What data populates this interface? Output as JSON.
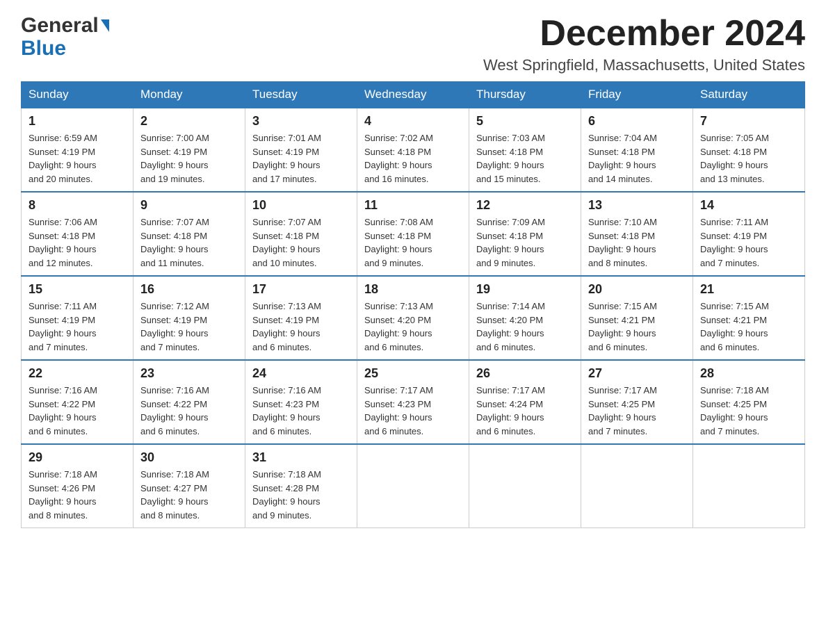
{
  "header": {
    "logo_general": "General",
    "logo_blue": "Blue",
    "month_title": "December 2024",
    "location": "West Springfield, Massachusetts, United States"
  },
  "days_of_week": [
    "Sunday",
    "Monday",
    "Tuesday",
    "Wednesday",
    "Thursday",
    "Friday",
    "Saturday"
  ],
  "weeks": [
    [
      {
        "day": "1",
        "sunrise": "6:59 AM",
        "sunset": "4:19 PM",
        "daylight": "9 hours and 20 minutes."
      },
      {
        "day": "2",
        "sunrise": "7:00 AM",
        "sunset": "4:19 PM",
        "daylight": "9 hours and 19 minutes."
      },
      {
        "day": "3",
        "sunrise": "7:01 AM",
        "sunset": "4:19 PM",
        "daylight": "9 hours and 17 minutes."
      },
      {
        "day": "4",
        "sunrise": "7:02 AM",
        "sunset": "4:18 PM",
        "daylight": "9 hours and 16 minutes."
      },
      {
        "day": "5",
        "sunrise": "7:03 AM",
        "sunset": "4:18 PM",
        "daylight": "9 hours and 15 minutes."
      },
      {
        "day": "6",
        "sunrise": "7:04 AM",
        "sunset": "4:18 PM",
        "daylight": "9 hours and 14 minutes."
      },
      {
        "day": "7",
        "sunrise": "7:05 AM",
        "sunset": "4:18 PM",
        "daylight": "9 hours and 13 minutes."
      }
    ],
    [
      {
        "day": "8",
        "sunrise": "7:06 AM",
        "sunset": "4:18 PM",
        "daylight": "9 hours and 12 minutes."
      },
      {
        "day": "9",
        "sunrise": "7:07 AM",
        "sunset": "4:18 PM",
        "daylight": "9 hours and 11 minutes."
      },
      {
        "day": "10",
        "sunrise": "7:07 AM",
        "sunset": "4:18 PM",
        "daylight": "9 hours and 10 minutes."
      },
      {
        "day": "11",
        "sunrise": "7:08 AM",
        "sunset": "4:18 PM",
        "daylight": "9 hours and 9 minutes."
      },
      {
        "day": "12",
        "sunrise": "7:09 AM",
        "sunset": "4:18 PM",
        "daylight": "9 hours and 9 minutes."
      },
      {
        "day": "13",
        "sunrise": "7:10 AM",
        "sunset": "4:18 PM",
        "daylight": "9 hours and 8 minutes."
      },
      {
        "day": "14",
        "sunrise": "7:11 AM",
        "sunset": "4:19 PM",
        "daylight": "9 hours and 7 minutes."
      }
    ],
    [
      {
        "day": "15",
        "sunrise": "7:11 AM",
        "sunset": "4:19 PM",
        "daylight": "9 hours and 7 minutes."
      },
      {
        "day": "16",
        "sunrise": "7:12 AM",
        "sunset": "4:19 PM",
        "daylight": "9 hours and 7 minutes."
      },
      {
        "day": "17",
        "sunrise": "7:13 AM",
        "sunset": "4:19 PM",
        "daylight": "9 hours and 6 minutes."
      },
      {
        "day": "18",
        "sunrise": "7:13 AM",
        "sunset": "4:20 PM",
        "daylight": "9 hours and 6 minutes."
      },
      {
        "day": "19",
        "sunrise": "7:14 AM",
        "sunset": "4:20 PM",
        "daylight": "9 hours and 6 minutes."
      },
      {
        "day": "20",
        "sunrise": "7:15 AM",
        "sunset": "4:21 PM",
        "daylight": "9 hours and 6 minutes."
      },
      {
        "day": "21",
        "sunrise": "7:15 AM",
        "sunset": "4:21 PM",
        "daylight": "9 hours and 6 minutes."
      }
    ],
    [
      {
        "day": "22",
        "sunrise": "7:16 AM",
        "sunset": "4:22 PM",
        "daylight": "9 hours and 6 minutes."
      },
      {
        "day": "23",
        "sunrise": "7:16 AM",
        "sunset": "4:22 PM",
        "daylight": "9 hours and 6 minutes."
      },
      {
        "day": "24",
        "sunrise": "7:16 AM",
        "sunset": "4:23 PM",
        "daylight": "9 hours and 6 minutes."
      },
      {
        "day": "25",
        "sunrise": "7:17 AM",
        "sunset": "4:23 PM",
        "daylight": "9 hours and 6 minutes."
      },
      {
        "day": "26",
        "sunrise": "7:17 AM",
        "sunset": "4:24 PM",
        "daylight": "9 hours and 6 minutes."
      },
      {
        "day": "27",
        "sunrise": "7:17 AM",
        "sunset": "4:25 PM",
        "daylight": "9 hours and 7 minutes."
      },
      {
        "day": "28",
        "sunrise": "7:18 AM",
        "sunset": "4:25 PM",
        "daylight": "9 hours and 7 minutes."
      }
    ],
    [
      {
        "day": "29",
        "sunrise": "7:18 AM",
        "sunset": "4:26 PM",
        "daylight": "9 hours and 8 minutes."
      },
      {
        "day": "30",
        "sunrise": "7:18 AM",
        "sunset": "4:27 PM",
        "daylight": "9 hours and 8 minutes."
      },
      {
        "day": "31",
        "sunrise": "7:18 AM",
        "sunset": "4:28 PM",
        "daylight": "9 hours and 9 minutes."
      },
      null,
      null,
      null,
      null
    ]
  ],
  "labels": {
    "sunrise": "Sunrise:",
    "sunset": "Sunset:",
    "daylight": "Daylight:"
  }
}
